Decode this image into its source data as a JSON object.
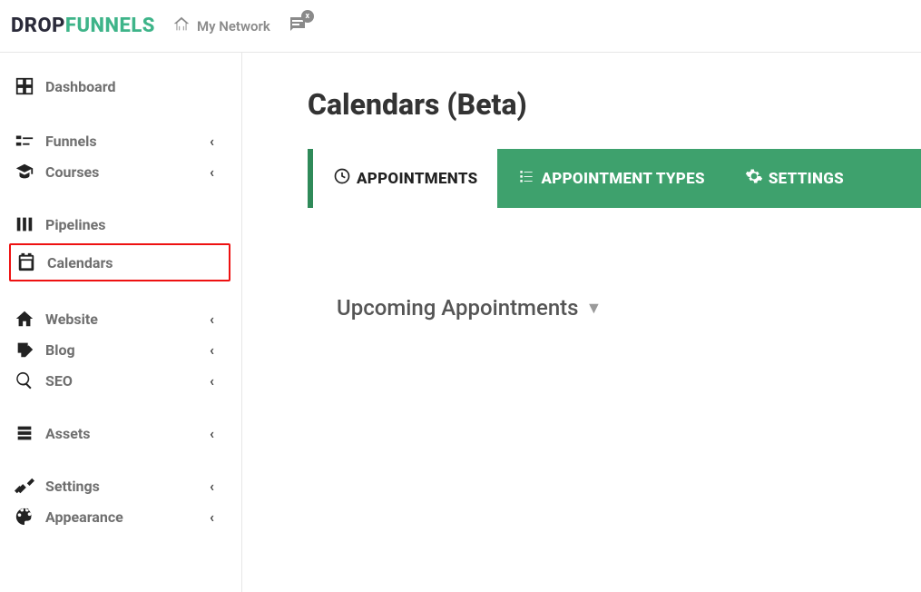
{
  "header": {
    "logo_part1": "DROP",
    "logo_part2": "FUNNELS",
    "network_label": "My Network",
    "chat_badge": "x"
  },
  "sidebar": {
    "dashboard": "Dashboard",
    "funnels": "Funnels",
    "courses": "Courses",
    "pipelines": "Pipelines",
    "calendars": "Calendars",
    "website": "Website",
    "blog": "Blog",
    "seo": "SEO",
    "assets": "Assets",
    "settings": "Settings",
    "appearance": "Appearance"
  },
  "main": {
    "title": "Calendars (Beta)",
    "tabs": {
      "appointments": "APPOINTMENTS",
      "types": "APPOINTMENT TYPES",
      "settings": "SETTINGS"
    },
    "section": "Upcoming Appointments"
  }
}
